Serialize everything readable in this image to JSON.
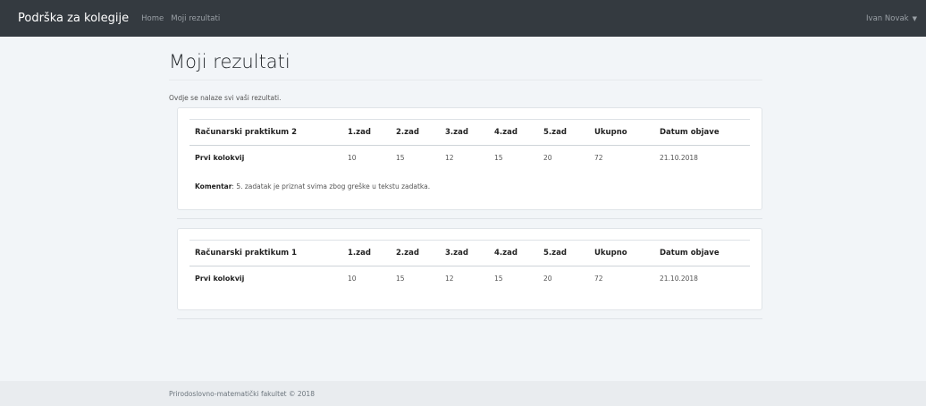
{
  "navbar": {
    "brand": "Podrška za kolegije",
    "links": [
      "Home",
      "Moji rezultati"
    ],
    "user": "Ivan Novak",
    "caret": "▼"
  },
  "page": {
    "title": "Moji rezultati",
    "intro": "Ovdje se nalaze svi vaši rezultati."
  },
  "results": [
    {
      "headers": [
        "Računarski praktikum 2",
        "1.zad",
        "2.zad",
        "3.zad",
        "4.zad",
        "5.zad",
        "Ukupno",
        "Datum objave"
      ],
      "row": [
        "Prvi kolokvij",
        "10",
        "15",
        "12",
        "15",
        "20",
        "72",
        "21.10.2018"
      ],
      "comment_label": "Komentar",
      "comment_text": ": 5. zadatak je priznat svima zbog greške u tekstu zadatka."
    },
    {
      "headers": [
        "Računarski praktikum 1",
        "1.zad",
        "2.zad",
        "3.zad",
        "4.zad",
        "5.zad",
        "Ukupno",
        "Datum objave"
      ],
      "row": [
        "Prvi kolokvij",
        "10",
        "15",
        "12",
        "15",
        "20",
        "72",
        "21.10.2018"
      ]
    }
  ],
  "footer": {
    "text": "Prirodoslovno-matematički fakultet © 2018"
  }
}
